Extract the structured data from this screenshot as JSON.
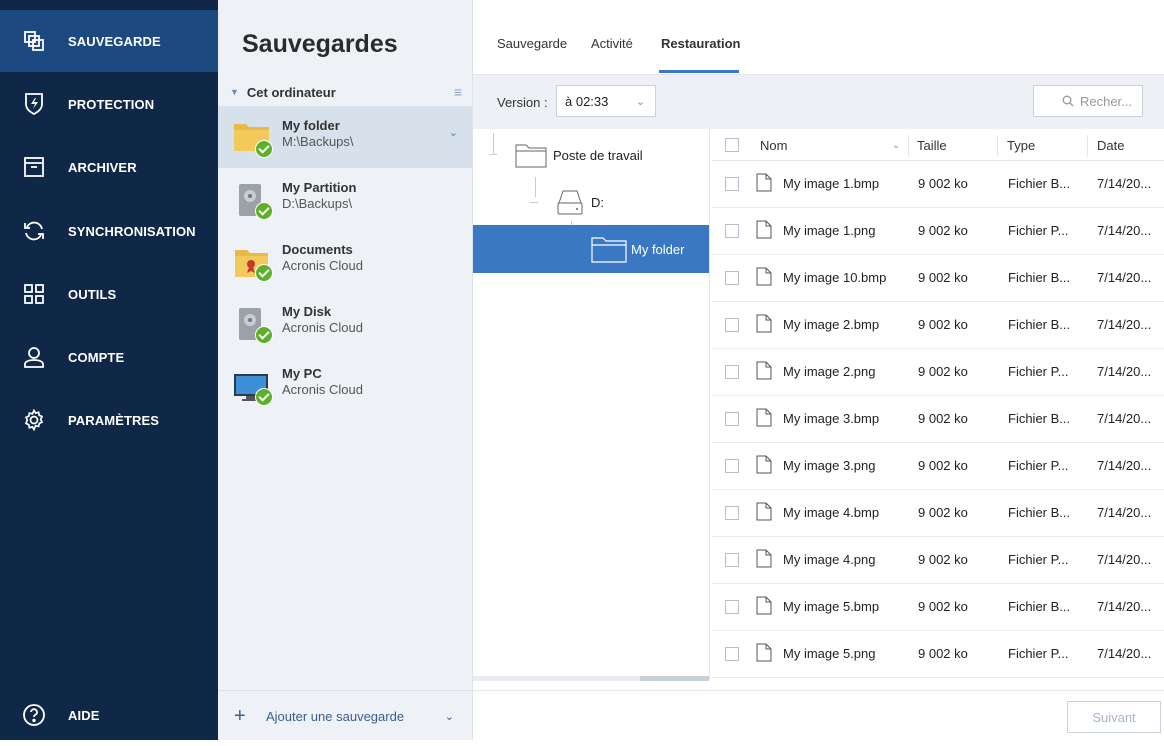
{
  "nav": {
    "items": [
      {
        "label": "SAUVEGARDE",
        "icon": "backup-copy-icon",
        "active": true
      },
      {
        "label": "PROTECTION",
        "icon": "shield-icon"
      },
      {
        "label": "ARCHIVER",
        "icon": "archive-box-icon"
      },
      {
        "label": "SYNCHRONISATION",
        "icon": "sync-icon"
      },
      {
        "label": "OUTILS",
        "icon": "tools-grid-icon"
      },
      {
        "label": "COMPTE",
        "icon": "account-icon"
      },
      {
        "label": "PARAMÈTRES",
        "icon": "gear-icon"
      }
    ],
    "help": {
      "label": "AIDE",
      "icon": "help-icon"
    }
  },
  "list": {
    "title": "Sauvegardes",
    "group": "Cet ordinateur",
    "items": [
      {
        "name": "My folder",
        "location": "M:\\Backups\\",
        "icon": "folder-icon"
      },
      {
        "name": "My Partition",
        "location": "D:\\Backups\\",
        "icon": "drive-icon"
      },
      {
        "name": "Documents",
        "location": "Acronis Cloud",
        "icon": "documents-folder-icon"
      },
      {
        "name": "My Disk",
        "location": "Acronis Cloud",
        "icon": "drive-icon"
      },
      {
        "name": "My PC",
        "location": "Acronis Cloud",
        "icon": "monitor-icon"
      }
    ],
    "add_label": "Ajouter une sauvegarde"
  },
  "main": {
    "tabs": [
      "Sauvegarde",
      "Activité",
      "Restauration"
    ],
    "version_label": "Version :",
    "version_value": "à 02:33",
    "search_placeholder": "Recher...",
    "tree": [
      "Poste de travail",
      "D:",
      "My folder"
    ],
    "columns": [
      "Nom",
      "Taille",
      "Type",
      "Date"
    ],
    "files": [
      {
        "name": "My image 1.bmp",
        "size": "9 002 ko",
        "type": "Fichier B...",
        "date": "7/14/20..."
      },
      {
        "name": "My image 1.png",
        "size": "9 002 ko",
        "type": "Fichier P...",
        "date": "7/14/20..."
      },
      {
        "name": "My image 10.bmp",
        "size": "9 002 ko",
        "type": "Fichier B...",
        "date": "7/14/20..."
      },
      {
        "name": "My image 2.bmp",
        "size": "9 002 ko",
        "type": "Fichier B...",
        "date": "7/14/20..."
      },
      {
        "name": "My image 2.png",
        "size": "9 002 ko",
        "type": "Fichier P...",
        "date": "7/14/20..."
      },
      {
        "name": "My image 3.bmp",
        "size": "9 002 ko",
        "type": "Fichier B...",
        "date": "7/14/20..."
      },
      {
        "name": "My image 3.png",
        "size": "9 002 ko",
        "type": "Fichier P...",
        "date": "7/14/20..."
      },
      {
        "name": "My image 4.bmp",
        "size": "9 002 ko",
        "type": "Fichier B...",
        "date": "7/14/20..."
      },
      {
        "name": "My image 4.png",
        "size": "9 002 ko",
        "type": "Fichier P...",
        "date": "7/14/20..."
      },
      {
        "name": "My image 5.bmp",
        "size": "9 002 ko",
        "type": "Fichier B...",
        "date": "7/14/20..."
      },
      {
        "name": "My image 5.png",
        "size": "9 002 ko",
        "type": "Fichier P...",
        "date": "7/14/20..."
      }
    ],
    "next_label": "Suivant"
  },
  "colors": {
    "nav_bg": "#0f2847",
    "nav_active": "#1c4980",
    "accent": "#3b78c4",
    "success": "#5cb02b"
  }
}
